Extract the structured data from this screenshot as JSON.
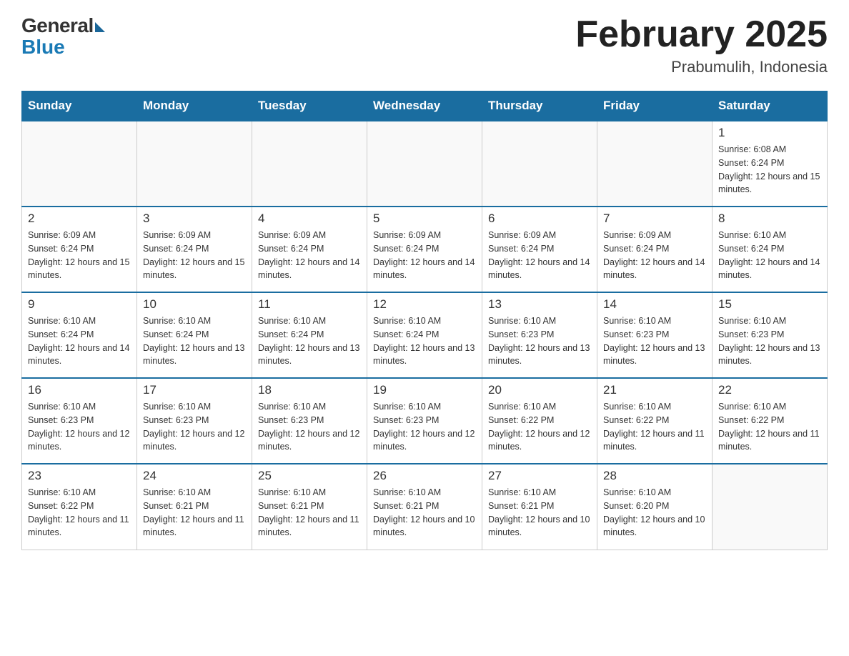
{
  "header": {
    "logo_general": "General",
    "logo_blue": "Blue",
    "month_title": "February 2025",
    "location": "Prabumulih, Indonesia"
  },
  "days_of_week": [
    "Sunday",
    "Monday",
    "Tuesday",
    "Wednesday",
    "Thursday",
    "Friday",
    "Saturday"
  ],
  "weeks": [
    [
      {
        "day": "",
        "info": ""
      },
      {
        "day": "",
        "info": ""
      },
      {
        "day": "",
        "info": ""
      },
      {
        "day": "",
        "info": ""
      },
      {
        "day": "",
        "info": ""
      },
      {
        "day": "",
        "info": ""
      },
      {
        "day": "1",
        "info": "Sunrise: 6:08 AM\nSunset: 6:24 PM\nDaylight: 12 hours and 15 minutes."
      }
    ],
    [
      {
        "day": "2",
        "info": "Sunrise: 6:09 AM\nSunset: 6:24 PM\nDaylight: 12 hours and 15 minutes."
      },
      {
        "day": "3",
        "info": "Sunrise: 6:09 AM\nSunset: 6:24 PM\nDaylight: 12 hours and 15 minutes."
      },
      {
        "day": "4",
        "info": "Sunrise: 6:09 AM\nSunset: 6:24 PM\nDaylight: 12 hours and 14 minutes."
      },
      {
        "day": "5",
        "info": "Sunrise: 6:09 AM\nSunset: 6:24 PM\nDaylight: 12 hours and 14 minutes."
      },
      {
        "day": "6",
        "info": "Sunrise: 6:09 AM\nSunset: 6:24 PM\nDaylight: 12 hours and 14 minutes."
      },
      {
        "day": "7",
        "info": "Sunrise: 6:09 AM\nSunset: 6:24 PM\nDaylight: 12 hours and 14 minutes."
      },
      {
        "day": "8",
        "info": "Sunrise: 6:10 AM\nSunset: 6:24 PM\nDaylight: 12 hours and 14 minutes."
      }
    ],
    [
      {
        "day": "9",
        "info": "Sunrise: 6:10 AM\nSunset: 6:24 PM\nDaylight: 12 hours and 14 minutes."
      },
      {
        "day": "10",
        "info": "Sunrise: 6:10 AM\nSunset: 6:24 PM\nDaylight: 12 hours and 13 minutes."
      },
      {
        "day": "11",
        "info": "Sunrise: 6:10 AM\nSunset: 6:24 PM\nDaylight: 12 hours and 13 minutes."
      },
      {
        "day": "12",
        "info": "Sunrise: 6:10 AM\nSunset: 6:24 PM\nDaylight: 12 hours and 13 minutes."
      },
      {
        "day": "13",
        "info": "Sunrise: 6:10 AM\nSunset: 6:23 PM\nDaylight: 12 hours and 13 minutes."
      },
      {
        "day": "14",
        "info": "Sunrise: 6:10 AM\nSunset: 6:23 PM\nDaylight: 12 hours and 13 minutes."
      },
      {
        "day": "15",
        "info": "Sunrise: 6:10 AM\nSunset: 6:23 PM\nDaylight: 12 hours and 13 minutes."
      }
    ],
    [
      {
        "day": "16",
        "info": "Sunrise: 6:10 AM\nSunset: 6:23 PM\nDaylight: 12 hours and 12 minutes."
      },
      {
        "day": "17",
        "info": "Sunrise: 6:10 AM\nSunset: 6:23 PM\nDaylight: 12 hours and 12 minutes."
      },
      {
        "day": "18",
        "info": "Sunrise: 6:10 AM\nSunset: 6:23 PM\nDaylight: 12 hours and 12 minutes."
      },
      {
        "day": "19",
        "info": "Sunrise: 6:10 AM\nSunset: 6:23 PM\nDaylight: 12 hours and 12 minutes."
      },
      {
        "day": "20",
        "info": "Sunrise: 6:10 AM\nSunset: 6:22 PM\nDaylight: 12 hours and 12 minutes."
      },
      {
        "day": "21",
        "info": "Sunrise: 6:10 AM\nSunset: 6:22 PM\nDaylight: 12 hours and 11 minutes."
      },
      {
        "day": "22",
        "info": "Sunrise: 6:10 AM\nSunset: 6:22 PM\nDaylight: 12 hours and 11 minutes."
      }
    ],
    [
      {
        "day": "23",
        "info": "Sunrise: 6:10 AM\nSunset: 6:22 PM\nDaylight: 12 hours and 11 minutes."
      },
      {
        "day": "24",
        "info": "Sunrise: 6:10 AM\nSunset: 6:21 PM\nDaylight: 12 hours and 11 minutes."
      },
      {
        "day": "25",
        "info": "Sunrise: 6:10 AM\nSunset: 6:21 PM\nDaylight: 12 hours and 11 minutes."
      },
      {
        "day": "26",
        "info": "Sunrise: 6:10 AM\nSunset: 6:21 PM\nDaylight: 12 hours and 10 minutes."
      },
      {
        "day": "27",
        "info": "Sunrise: 6:10 AM\nSunset: 6:21 PM\nDaylight: 12 hours and 10 minutes."
      },
      {
        "day": "28",
        "info": "Sunrise: 6:10 AM\nSunset: 6:20 PM\nDaylight: 12 hours and 10 minutes."
      },
      {
        "day": "",
        "info": ""
      }
    ]
  ]
}
